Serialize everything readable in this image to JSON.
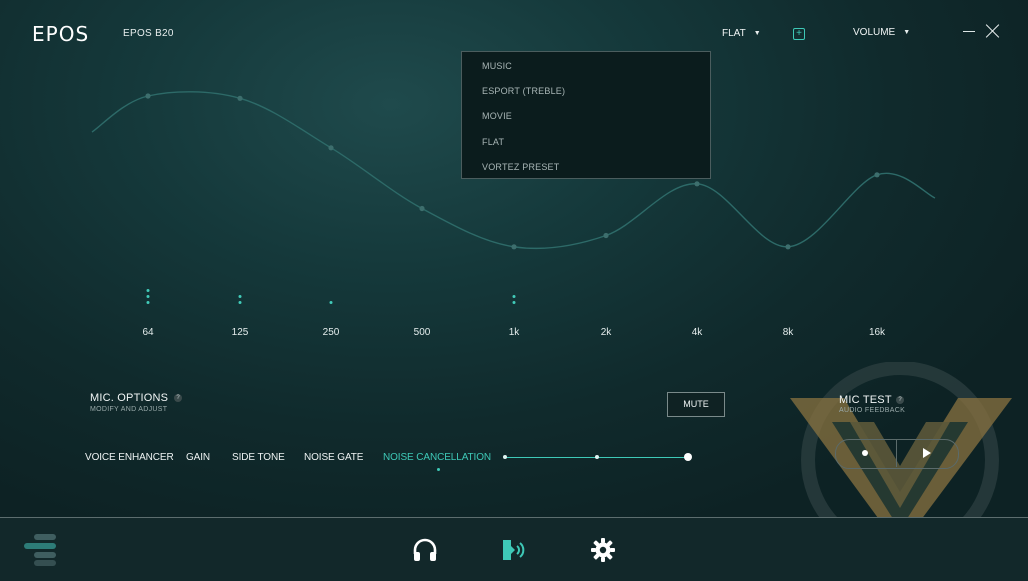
{
  "header": {
    "logo": "EPOS",
    "device": "EPOS B20",
    "eq_preset": "FLAT",
    "volume_label": "VOLUME",
    "add_glyph": "+"
  },
  "preset_menu": {
    "items": [
      "MUSIC",
      "ESPORT (TREBLE)",
      "MOVIE",
      "FLAT",
      "VORTEZ PRESET"
    ]
  },
  "equalizer": {
    "frequencies": [
      "64",
      "125",
      "250",
      "500",
      "1k",
      "2k",
      "4k",
      "8k",
      "16k"
    ],
    "curve_level": [
      0.84,
      0.83,
      0.61,
      0.34,
      0.17,
      0.22,
      0.45,
      0.17,
      0.49
    ],
    "bar_dots": [
      3,
      2,
      1,
      0,
      2,
      0,
      0,
      0,
      0
    ]
  },
  "mic_options": {
    "title": "MIC. OPTIONS",
    "subtitle": "MODIFY AND ADJUST",
    "help": "?",
    "mute_label": "MUTE",
    "tabs": [
      "VOICE ENHANCER",
      "GAIN",
      "SIDE TONE",
      "NOISE GATE",
      "NOISE CANCELLATION"
    ],
    "active_tab": "NOISE CANCELLATION",
    "noise_cancellation_level": 1.0,
    "noise_cancellation_steps": 3
  },
  "mic_test": {
    "title": "MIC TEST",
    "subtitle": "AUDIO FEEDBACK",
    "help": "?"
  },
  "bottom_nav": {
    "items": [
      "headphones-icon",
      "microphone-icon",
      "gear-icon"
    ],
    "active": "microphone-icon"
  },
  "colors": {
    "accent": "#3ec9b7",
    "background": "#15393b",
    "watermark": "#8a7340"
  }
}
